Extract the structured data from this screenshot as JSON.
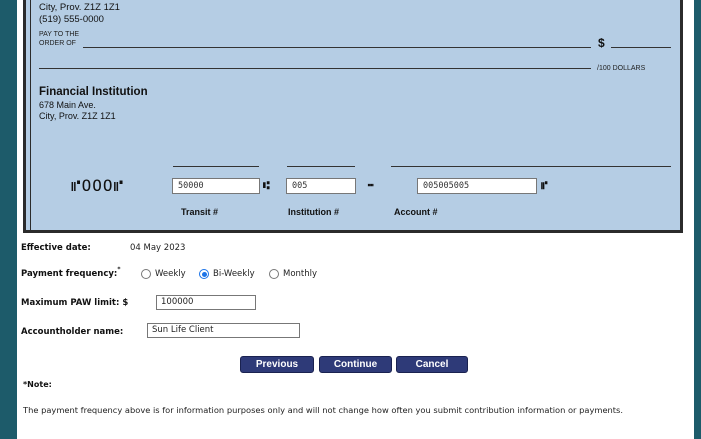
{
  "cheque": {
    "payer_city": "City, Prov. Z1Z 1Z1",
    "payer_phone": "(519) 555-0000",
    "pay_to_line1": "PAY TO THE",
    "pay_to_line2": "ORDER OF",
    "dollar_sign": "$",
    "dollars_suffix": "/100 DOLLARS",
    "bank_name": "Financial Institution",
    "bank_address": "678 Main Ave.",
    "bank_city": "City, Prov. Z1Z 1Z1",
    "micr_cheque_no": "⑈OOO⑈",
    "transit_value": "50000",
    "institution_value": "005",
    "account_value": "005005005",
    "transit_label": "Transit #",
    "institution_label": "Institution #",
    "account_label": "Account #"
  },
  "form": {
    "effective_date_label": "Effective date:",
    "effective_date_value": "04 May 2023",
    "frequency_label": "Payment frequency:",
    "frequency_marker": "*",
    "frequency_options": [
      {
        "label": "Weekly",
        "selected": false
      },
      {
        "label": "Bi-Weekly",
        "selected": true
      },
      {
        "label": "Monthly",
        "selected": false
      }
    ],
    "max_limit_label": "Maximum PAW limit: $",
    "max_limit_value": "100000",
    "accountholder_label": "Accountholder name:",
    "accountholder_value": "Sun Life Client"
  },
  "buttons": {
    "previous": "Previous",
    "continue": "Continue",
    "cancel": "Cancel"
  },
  "note": {
    "title": "*Note:",
    "text": "The payment frequency above is for information purposes only and will not change how often you submit contribution information or payments."
  },
  "colors": {
    "frame": "#1d5b6a",
    "cheque_bg": "#b5cde4",
    "button_bg": "#2e3a78",
    "radio_accent": "#1a73e8"
  }
}
